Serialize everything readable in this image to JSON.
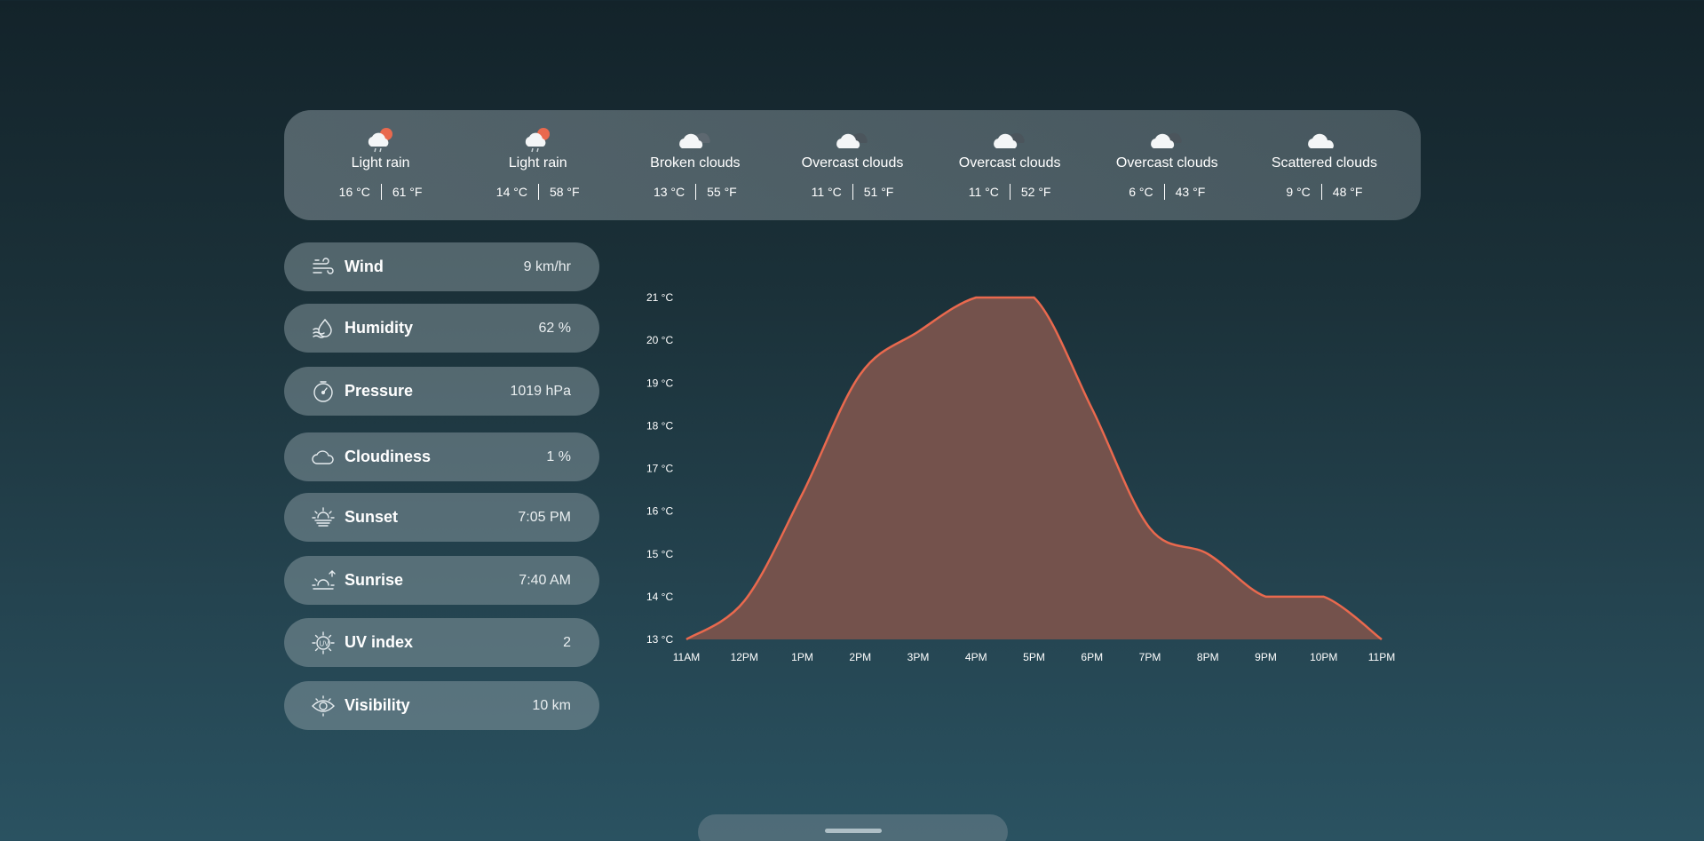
{
  "forecast": [
    {
      "icon": "light-rain-icon",
      "desc": "Light rain",
      "c": "16 °C",
      "f": "61 °F"
    },
    {
      "icon": "light-rain-icon",
      "desc": "Light rain",
      "c": "14 °C",
      "f": "58 °F"
    },
    {
      "icon": "broken-clouds-icon",
      "desc": "Broken clouds",
      "c": "13 °C",
      "f": "55 °F"
    },
    {
      "icon": "overcast-clouds-icon",
      "desc": "Overcast clouds",
      "c": "11 °C",
      "f": "51 °F"
    },
    {
      "icon": "overcast-clouds-icon",
      "desc": "Overcast clouds",
      "c": "11 °C",
      "f": "52 °F"
    },
    {
      "icon": "overcast-clouds-icon",
      "desc": "Overcast clouds",
      "c": "6 °C",
      "f": "43 °F"
    },
    {
      "icon": "scattered-clouds-icon",
      "desc": "Scattered clouds",
      "c": "9 °C",
      "f": "48 °F"
    }
  ],
  "metrics": [
    {
      "icon": "wind-icon",
      "label": "Wind",
      "value": "9 km/hr"
    },
    {
      "icon": "humidity-icon",
      "label": "Humidity",
      "value": "62 %"
    },
    {
      "icon": "pressure-icon",
      "label": "Pressure",
      "value": "1019 hPa"
    },
    {
      "icon": "cloud-icon",
      "label": "Cloudiness",
      "value": "1 %"
    },
    {
      "icon": "sunset-icon",
      "label": "Sunset",
      "value": "7:05 PM"
    },
    {
      "icon": "sunrise-icon",
      "label": "Sunrise",
      "value": "7:40 AM"
    },
    {
      "icon": "uv-index-icon",
      "label": "UV index",
      "value": "2"
    },
    {
      "icon": "visibility-icon",
      "label": "Visibility",
      "value": "10 km"
    }
  ],
  "colors": {
    "accent": "#e9694e",
    "area_fill": "#74524c",
    "text": "#ffffff"
  },
  "chart_data": {
    "type": "area",
    "x": [
      "11AM",
      "12PM",
      "1PM",
      "2PM",
      "3PM",
      "4PM",
      "5PM",
      "6PM",
      "7PM",
      "8PM",
      "9PM",
      "10PM",
      "11PM"
    ],
    "values": [
      13.0,
      13.9,
      16.4,
      19.2,
      20.2,
      21.0,
      21.0,
      18.4,
      15.6,
      15.0,
      14.0,
      14.0,
      13.0
    ],
    "yticks": [
      "13 °C",
      "14 °C",
      "15 °C",
      "16 °C",
      "17 °C",
      "18 °C",
      "19 °C",
      "20 °C",
      "21 °C"
    ],
    "ylim": [
      13,
      21
    ],
    "grid": false,
    "title": "",
    "xlabel": "",
    "ylabel": ""
  }
}
